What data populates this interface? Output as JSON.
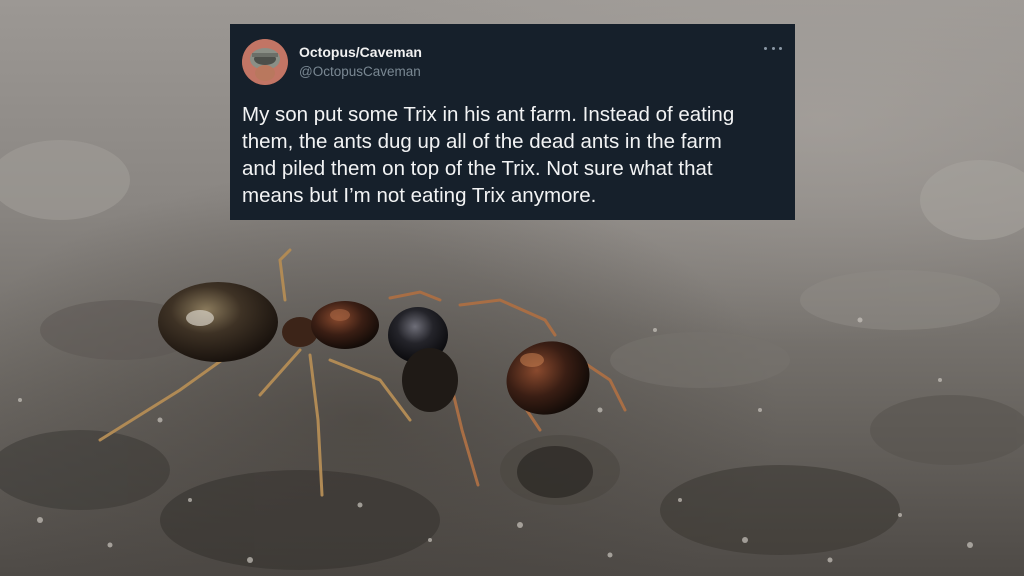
{
  "photo": {
    "subject": "ants-on-soil"
  },
  "tweet": {
    "display_name": "Octopus/Caveman",
    "handle": "@OctopusCaveman",
    "text": "My son put some Trix in his ant farm. Instead of eating\nthem, the ants dug up all of the dead ants in the farm\nand piled them on top of the Trix. Not sure what that\nmeans but I’m not eating Trix anymore.",
    "more_icon": "more-horizontal-icon",
    "colors": {
      "card_background": "#16202b",
      "text": "#f2f3f4",
      "handle": "#7a8893"
    }
  }
}
